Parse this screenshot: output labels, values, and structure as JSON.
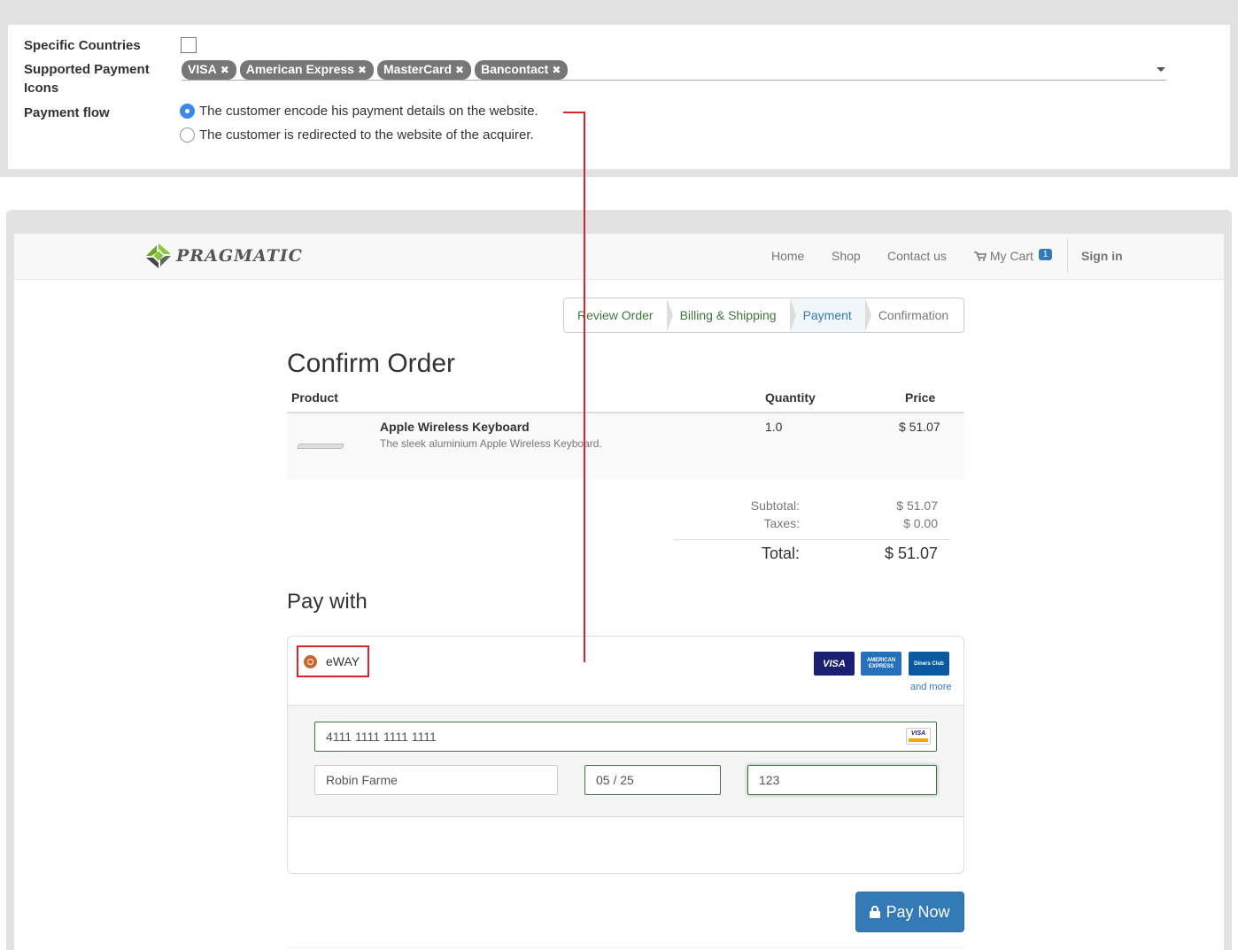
{
  "settings": {
    "specific_countries_label": "Specific Countries",
    "supported_icons_label": "Supported Payment Icons",
    "supported_icons_label_line1": "Supported Payment",
    "supported_icons_label_line2": "Icons",
    "tags": [
      "VISA",
      "American Express",
      "MasterCard",
      "Bancontact"
    ],
    "tag_remove_glyph": "✖",
    "payment_flow_label": "Payment flow",
    "flow_options": [
      {
        "label": "The customer encode his payment details on the website.",
        "selected": true
      },
      {
        "label": "The customer is redirected to the website of the acquirer.",
        "selected": false
      }
    ]
  },
  "navbar": {
    "brand": "Pragmatic",
    "brand_display": "PRAGMATIC",
    "links": [
      "Home",
      "Shop",
      "Contact us"
    ],
    "cart_label": "My Cart",
    "cart_count": "1",
    "sign_in": "Sign in"
  },
  "wizard": {
    "steps": [
      {
        "label": "Review Order",
        "state": "done"
      },
      {
        "label": "Billing & Shipping",
        "state": "done"
      },
      {
        "label": "Payment",
        "state": "active"
      },
      {
        "label": "Confirmation",
        "state": "todo"
      }
    ]
  },
  "order": {
    "title": "Confirm Order",
    "columns": {
      "product": "Product",
      "quantity": "Quantity",
      "price": "Price"
    },
    "lines": [
      {
        "name": "Apple Wireless Keyboard",
        "description": "The sleek aluminium Apple Wireless Keyboard.",
        "quantity": "1.0",
        "price": "$ 51.07"
      }
    ],
    "subtotal_label": "Subtotal:",
    "subtotal": "$ 51.07",
    "taxes_label": "Taxes:",
    "taxes": "$ 0.00",
    "total_label": "Total:",
    "total": "$ 51.07"
  },
  "payment": {
    "title": "Pay with",
    "acquirer": "eWAY",
    "card_icons": [
      {
        "name": "VISA",
        "color": "#1a1f71"
      },
      {
        "name": "AMERICAN EXPRESS",
        "color": "#2671b9"
      },
      {
        "name": "Diners Club",
        "color": "#0a5aa0"
      }
    ],
    "and_more": "and more",
    "card_number": "4111 1111 1111 1111",
    "card_brand_mini": "VISA",
    "card_holder": "Robin Farme",
    "expiry": "05 / 25",
    "cvc": "123",
    "pay_button": "Pay Now"
  },
  "colors": {
    "accent": "#337ab7",
    "success": "#3c763d",
    "annotation": "#d9262c",
    "radio_selected": "#3b88e7",
    "eway_radio": "#c8662e"
  }
}
